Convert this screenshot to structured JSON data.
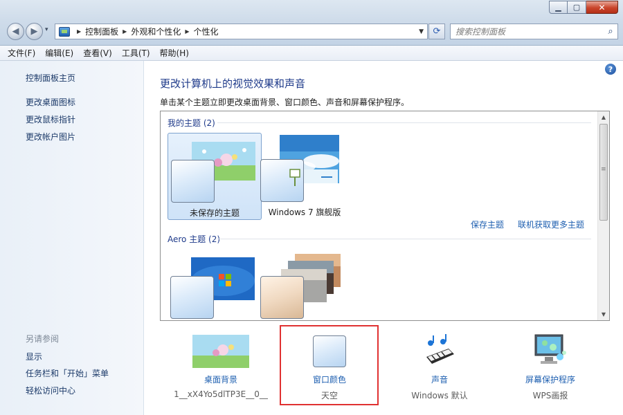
{
  "window": {
    "minimize_glyph": "▁",
    "maximize_glyph": "▢",
    "close_glyph": "✕"
  },
  "nav": {
    "back_glyph": "◀",
    "forward_glyph": "▶",
    "recent_glyph": "▾",
    "refresh_glyph": "⟳"
  },
  "address": {
    "crumbs": [
      "控制面板",
      "外观和个性化",
      "个性化"
    ],
    "sep_glyph": "▶",
    "dropdown_glyph": "▼"
  },
  "search": {
    "placeholder": "搜索控制面板",
    "icon_glyph": "⌕"
  },
  "menu": [
    "文件(F)",
    "编辑(E)",
    "查看(V)",
    "工具(T)",
    "帮助(H)"
  ],
  "sidebar": {
    "home": "控制面板主页",
    "links": [
      "更改桌面图标",
      "更改鼠标指针",
      "更改帐户图片"
    ],
    "see_also_header": "另请参阅",
    "see_also": [
      "显示",
      "任务栏和「开始」菜单",
      "轻松访问中心"
    ]
  },
  "main": {
    "help_glyph": "?",
    "title": "更改计算机上的视觉效果和声音",
    "description": "单击某个主题立即更改桌面背景、窗口颜色、声音和屏幕保护程序。",
    "my_themes": {
      "title": "我的主题 (2)",
      "items": [
        {
          "label": "未保存的主题",
          "selected": true
        },
        {
          "label": "Windows 7 旗舰版",
          "selected": false
        }
      ],
      "save_link": "保存主题",
      "online_link": "联机获取更多主题"
    },
    "aero_themes": {
      "title": "Aero 主题 (2)"
    },
    "scroll": {
      "up_glyph": "▲",
      "down_glyph": "▼",
      "grip_glyph": "≡"
    }
  },
  "settings": [
    {
      "name": "桌面背景",
      "value": "1__xX4Yo5dlTP3E__0__"
    },
    {
      "name": "窗口颜色",
      "value": "天空"
    },
    {
      "name": "声音",
      "value": "Windows 默认"
    },
    {
      "name": "屏幕保护程序",
      "value": "WPS画报"
    }
  ],
  "colors": {
    "link": "#1e5fb0",
    "title": "#1e3a8a",
    "highlight": "#e03131",
    "selected_bg": "#cfe3f8"
  }
}
